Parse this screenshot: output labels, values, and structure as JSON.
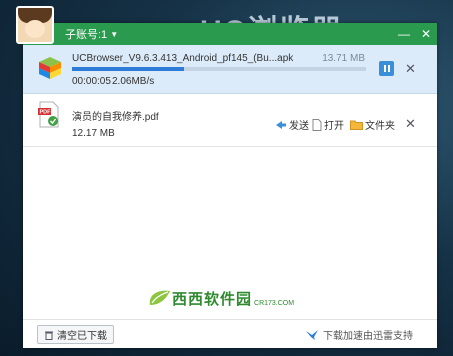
{
  "background": {
    "brand": "UC浏览器"
  },
  "titlebar": {
    "account": "子账号:1"
  },
  "downloads": [
    {
      "name": "UCBrowser_V9.6.3.413_Android_pf145_(Bu...apk",
      "size": "13.71 MB",
      "progress": 0.38,
      "time_left": "00:00:05",
      "speed": "2.06MB/s"
    },
    {
      "name": "演员的自我修养.pdf",
      "size": "12.17 MB"
    }
  ],
  "actions": {
    "send": "发送",
    "open": "打开",
    "folder": "文件夹"
  },
  "footer": {
    "clear": "清空已下载",
    "thunder": "下载加速由迅雷支持"
  },
  "watermark": {
    "text": "西西软件园",
    "sub": "CR173.COM"
  },
  "colors": {
    "titlebar": "#2a9a4e",
    "progress": "#2c7bd6",
    "active_row": "#dcebf9"
  }
}
